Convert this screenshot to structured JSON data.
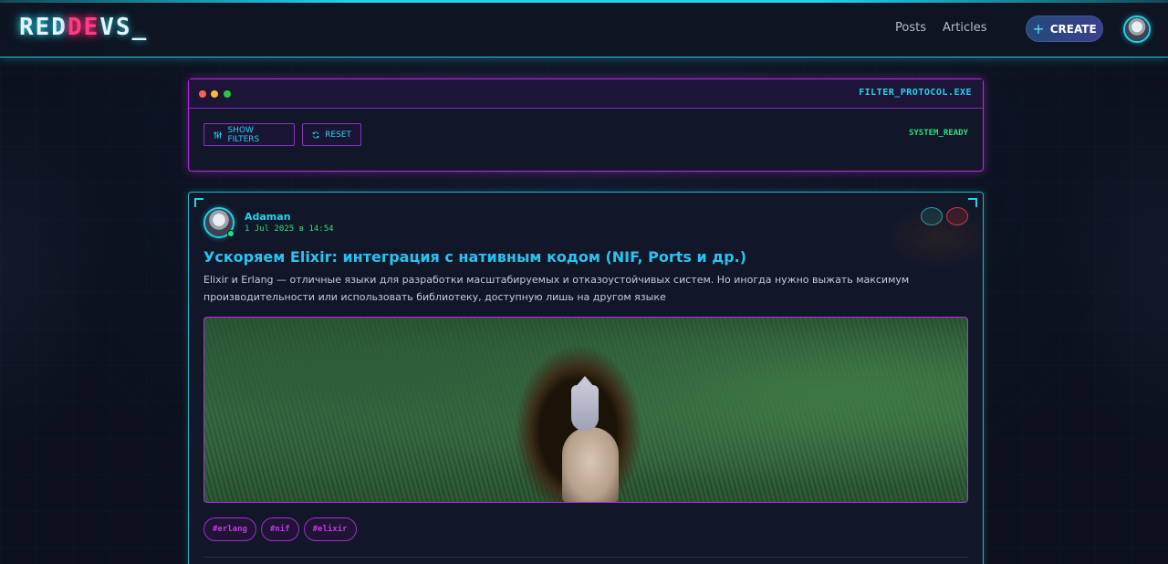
{
  "header": {
    "logo": {
      "part1": "RED",
      "part2": "DE",
      "part3": "VS_"
    },
    "nav": [
      {
        "label": "Posts"
      },
      {
        "label": "Articles"
      }
    ],
    "create_label": "CREATE",
    "create_icon": "plus-icon"
  },
  "filter_panel": {
    "window_title": "FILTER_PROTOCOL.EXE",
    "show_filters_label": "SHOW FILTERS",
    "show_filters_icon": "sliders-icon",
    "reset_label": "RESET",
    "reset_icon": "refresh-icon",
    "status": "SYSTEM_READY"
  },
  "post": {
    "author": "Adaman",
    "date": "1 Jul 2025 в 14:54",
    "title": "Ускоряем Elixir: интеграция с нативным кодом (NIF, Ports и др.)",
    "excerpt": "Elixir и Erlang — отличные языки для разработки масштабируемых и отказоустойчивых систем. Но иногда нужно выжать максимум производительности или использовать библиотеку, доступную лишь на другом языке",
    "tags": [
      "#erlang",
      "#nif",
      "#elixir"
    ]
  },
  "colors": {
    "accent_cyan": "#22d3ee",
    "accent_magenta": "#b62ee0",
    "accent_pink": "#ff2d78",
    "status_green": "#22e07a"
  }
}
